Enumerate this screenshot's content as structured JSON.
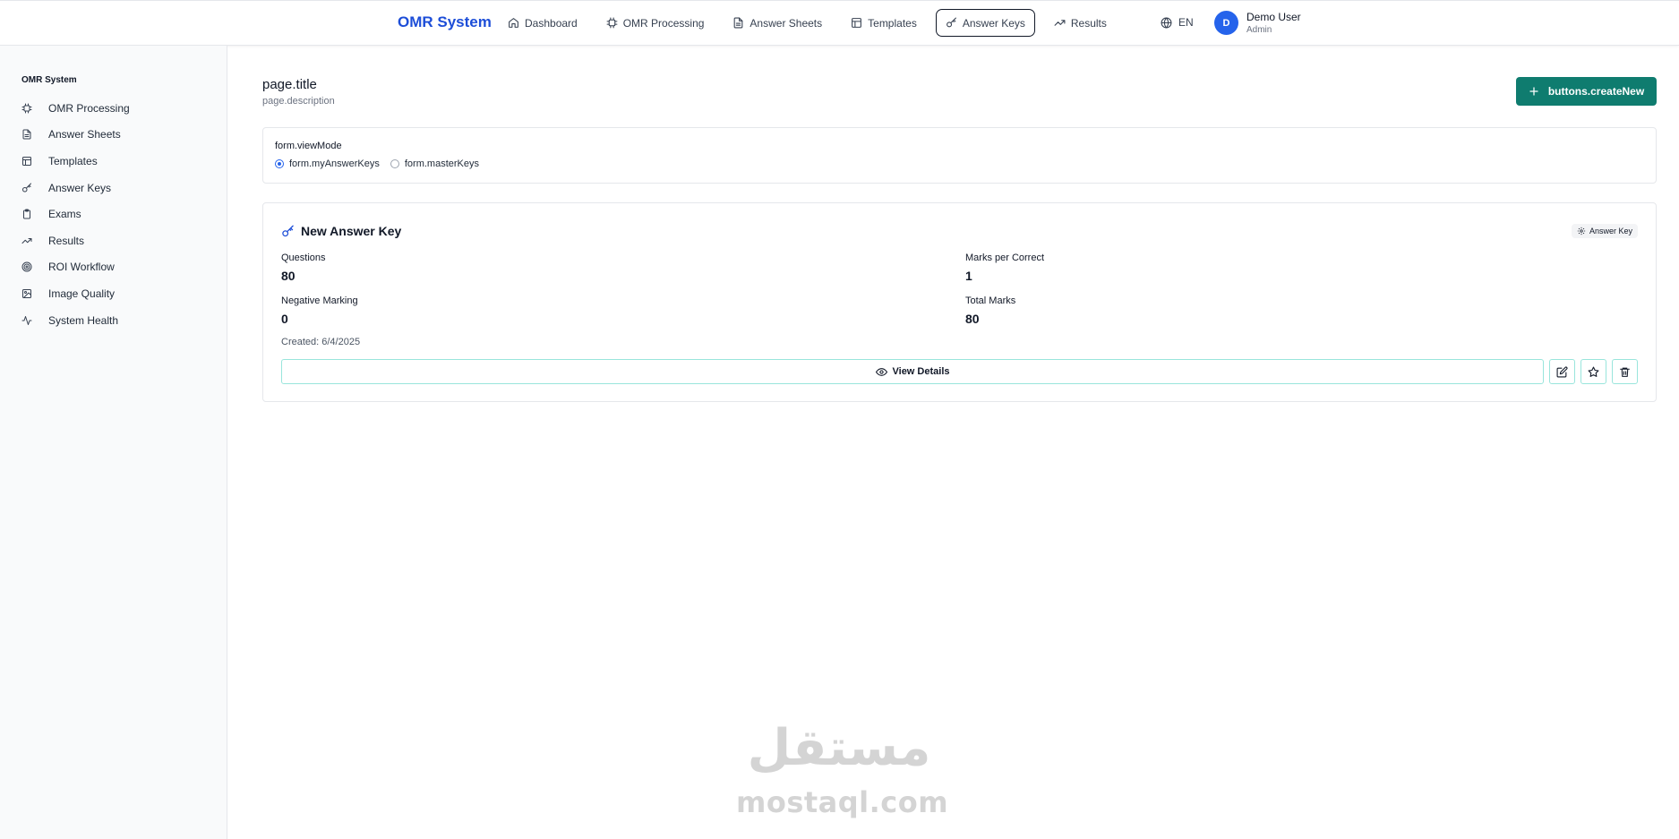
{
  "header": {
    "brand": "OMR System",
    "nav": [
      {
        "label": "Dashboard",
        "icon": "home-icon"
      },
      {
        "label": "OMR Processing",
        "icon": "cpu-icon"
      },
      {
        "label": "Answer Sheets",
        "icon": "file-text-icon"
      },
      {
        "label": "Templates",
        "icon": "layout-icon"
      },
      {
        "label": "Answer Keys",
        "icon": "key-icon",
        "active": true
      },
      {
        "label": "Results",
        "icon": "trending-up-icon"
      }
    ],
    "language": "EN",
    "user": {
      "initial": "D",
      "name": "Demo User",
      "role": "Admin"
    }
  },
  "sidebar": {
    "title": "OMR System",
    "items": [
      {
        "label": "OMR Processing",
        "icon": "cpu-icon"
      },
      {
        "label": "Answer Sheets",
        "icon": "file-text-icon"
      },
      {
        "label": "Templates",
        "icon": "layout-icon"
      },
      {
        "label": "Answer Keys",
        "icon": "key-icon"
      },
      {
        "label": "Exams",
        "icon": "clipboard-icon"
      },
      {
        "label": "Results",
        "icon": "trending-up-icon"
      },
      {
        "label": "ROI Workflow",
        "icon": "target-icon"
      },
      {
        "label": "Image Quality",
        "icon": "image-icon"
      },
      {
        "label": "System Health",
        "icon": "activity-icon"
      }
    ]
  },
  "page": {
    "title": "page.title",
    "description": "page.description",
    "create_button": "buttons.createNew"
  },
  "form": {
    "view_mode_label": "form.viewMode",
    "options": [
      {
        "label": "form.myAnswerKeys",
        "checked": true
      },
      {
        "label": "form.masterKeys",
        "checked": false
      }
    ]
  },
  "answer_key": {
    "title": "New Answer Key",
    "badge": "Answer Key",
    "questions_label": "Questions",
    "questions_value": "80",
    "marks_label": "Marks per Correct",
    "marks_value": "1",
    "negative_label": "Negative Marking",
    "negative_value": "0",
    "total_label": "Total Marks",
    "total_value": "80",
    "created": "Created: 6/4/2025",
    "view_button": "View Details"
  },
  "watermark": {
    "arabic": "مستقل",
    "latin": "mostaql.com"
  },
  "colors": {
    "brand": "#1d4ed8",
    "primary_button": "#0f7c6f",
    "avatar": "#2563eb",
    "outline_accent": "#99e5dc"
  }
}
